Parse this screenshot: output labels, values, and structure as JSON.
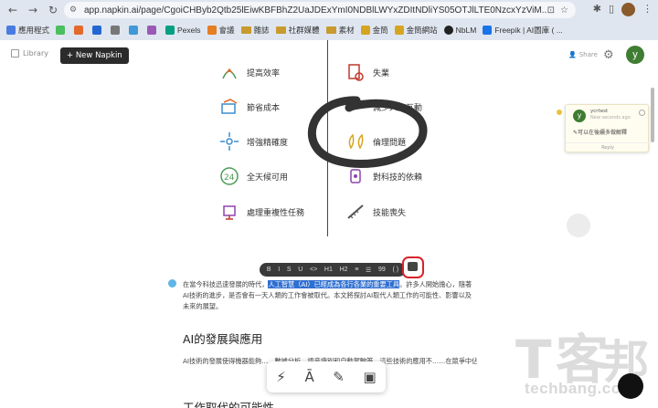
{
  "browser": {
    "url": "app.napkin.ai/page/CgoiCHByb2Qtb25lEiwKBFBhZ2UaJDExYmI0NDBlLWYxZDItNDliYS05OTJlLTE0NzcxYzViM...",
    "bookmarks": [
      "應用程式",
      "Pexels",
      "會議",
      "雜誌",
      "社群媒體",
      "素材",
      "金筒",
      "金筒網站",
      "NbLM",
      "Freepik | AI圖庫 ( ..."
    ]
  },
  "app": {
    "library_label": "Library",
    "new_napkin_label": "+ New Napkin",
    "share_label": "Share",
    "user_initial": "y"
  },
  "diagram": {
    "left_items": [
      "提高效率",
      "節省成本",
      "增強精確度",
      "全天候可用",
      "處理重複性任務"
    ],
    "right_items": [
      "失業",
      "減少人際互動",
      "倫理問題",
      "對科技的依賴",
      "技能喪失"
    ]
  },
  "comment": {
    "author_initial": "y",
    "author": "ycrtest",
    "time": "New seconds ago",
    "text": "可以在後續多做解釋",
    "reply_label": "Reply"
  },
  "toolbar": {
    "items": [
      "B",
      "I",
      "S",
      "U",
      "<>",
      "H1",
      "H2",
      "≡",
      "☰",
      "99",
      "( )"
    ]
  },
  "doc": {
    "para1_before": "在當今科技迅速發展的時代，",
    "para1_highlight": "人工智慧（AI）已經成為各行各業的重要工具",
    "para1_after": "。許多人開始擔心，隨著AI技術的進步，是否會有一天人類的工作會被取代。本文將探討AI取代人類工作的可能性、影響以及未來的展望。",
    "heading1": "AI的發展與應用",
    "para2": "AI技術的發展使得機器能夠……數據分析、語音識別和自動駕駛等。這些技術的應用不……在競爭中佔據優勢。",
    "heading2": "工作取代的可能性"
  },
  "watermark": {
    "text": "techbang.com"
  }
}
